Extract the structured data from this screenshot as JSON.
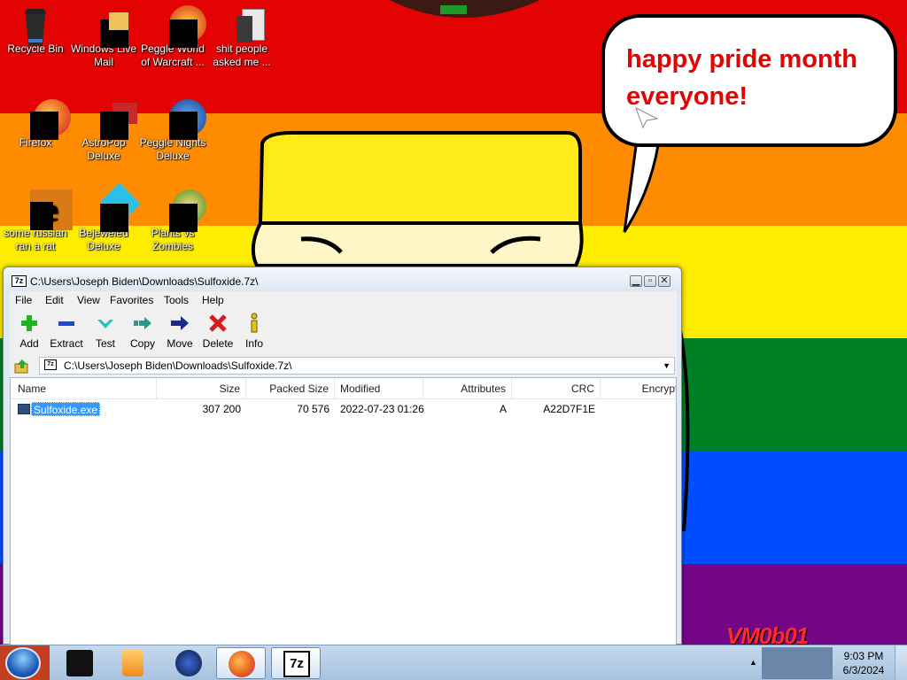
{
  "desktop": {
    "icons": [
      {
        "label": "Recycle Bin",
        "icon": "recycle-bin-icon"
      },
      {
        "label": "Windows Live Mail",
        "icon": "windows-live-mail-icon"
      },
      {
        "label": "Peggle World of Warcraft ...",
        "icon": "peggle-wow-icon"
      },
      {
        "label": "shit people asked me ...",
        "icon": "folder-icon"
      },
      {
        "label": "Firefox",
        "icon": "firefox-icon"
      },
      {
        "label": "AstroPop Deluxe",
        "icon": "astropop-icon"
      },
      {
        "label": "Peggle Nights Deluxe",
        "icon": "peggle-nights-icon"
      },
      {
        "label": "some russian ran a rat",
        "icon": "ie-icon"
      },
      {
        "label": "Bejeweled Deluxe",
        "icon": "bejeweled-icon"
      },
      {
        "label": "Plants vs Zombies",
        "icon": "plants-vs-zombies-icon"
      }
    ],
    "bubble_text": "happy pride month everyone!",
    "watermark": "VM0b01",
    "stripe_colors": [
      "#e40303",
      "#ff8c00",
      "#ffed00",
      "#008026",
      "#004dff",
      "#750787"
    ]
  },
  "window": {
    "app_icon_text": "7z",
    "title": "C:\\Users\\Joseph Biden\\Downloads\\Sulfoxide.7z\\",
    "menu": [
      "File",
      "Edit",
      "View",
      "Favorites",
      "Tools",
      "Help"
    ],
    "toolbar": [
      {
        "label": "Add",
        "icon": "add-icon"
      },
      {
        "label": "Extract",
        "icon": "extract-icon"
      },
      {
        "label": "Test",
        "icon": "test-icon"
      },
      {
        "label": "Copy",
        "icon": "copy-icon"
      },
      {
        "label": "Move",
        "icon": "move-icon"
      },
      {
        "label": "Delete",
        "icon": "delete-icon"
      },
      {
        "label": "Info",
        "icon": "info-icon"
      }
    ],
    "address": "C:\\Users\\Joseph Biden\\Downloads\\Sulfoxide.7z\\",
    "columns": [
      "Name",
      "Size",
      "Packed Size",
      "Modified",
      "Attributes",
      "CRC",
      "Encrypte"
    ],
    "rows": [
      {
        "name": "Sulfoxide.exe",
        "size": "307 200",
        "packed_size": "70 576",
        "modified": "2022-07-23 01:26",
        "attributes": "A",
        "crc": "A22D7F1E",
        "encrypted": ""
      }
    ]
  },
  "taskbar": {
    "items": [
      "dark-app-icon",
      "media-player-icon",
      "globe-icon",
      "firefox-icon",
      "7zip-icon"
    ],
    "clock_time": "9:03 PM",
    "clock_date": "6/3/2024",
    "accent": "#3399ff"
  }
}
